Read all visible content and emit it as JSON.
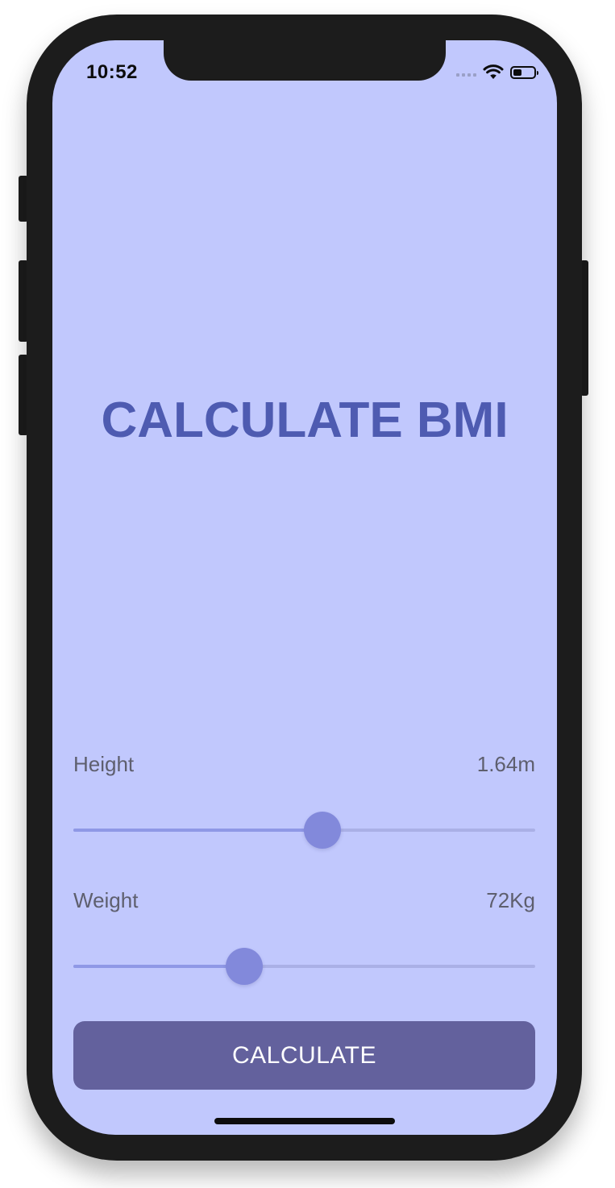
{
  "status_bar": {
    "time": "10:52",
    "icons": [
      "cellular-signal-icon",
      "wifi-icon",
      "battery-icon"
    ]
  },
  "app": {
    "title": "CALCULATE BMI",
    "background_color": "#c1c8fd",
    "accent_color": "#4e5bb1"
  },
  "height_slider": {
    "label": "Height",
    "value_text": "1.64m",
    "fraction": 0.54
  },
  "weight_slider": {
    "label": "Weight",
    "value_text": "72Kg",
    "fraction": 0.37
  },
  "calculate_button": {
    "label": "CALCULATE",
    "color": "#63619d"
  }
}
